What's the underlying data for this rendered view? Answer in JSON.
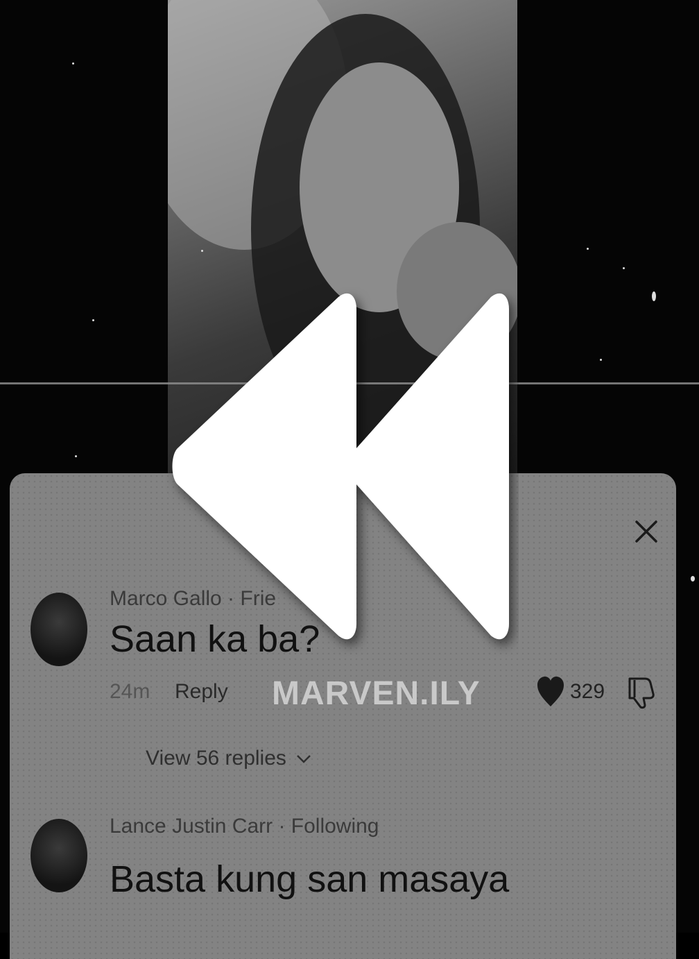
{
  "comments": [
    {
      "author": "Marco Gallo · Frie",
      "text": "Saan ka ba?",
      "time": "24m",
      "reply_label": "Reply",
      "likes": "329",
      "view_replies_label": "View 56 replies"
    },
    {
      "author": "Lance Justin Carr · Following",
      "text": "Basta kung san masaya"
    }
  ],
  "watermark": "MARVEN.ILY",
  "icons": {
    "close": "close-icon",
    "rewind": "rewind-icon",
    "like": "heart-icon",
    "dislike": "thumbs-down-icon",
    "chevron": "chevron-down-icon"
  }
}
